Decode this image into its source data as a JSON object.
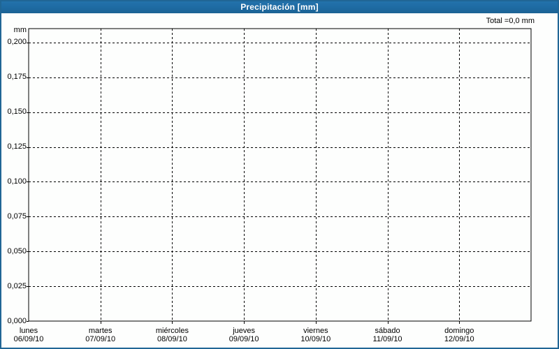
{
  "window": {
    "title": "Precipitación [mm]"
  },
  "chart_data": {
    "type": "bar",
    "title": "Precipitación [mm]",
    "total_annotation": "Total =0,0 mm",
    "grid": true,
    "legend_position": "none",
    "y_axis": {
      "unit_label": "mm",
      "tick_values": [
        0,
        0.025,
        0.05,
        0.075,
        0.1,
        0.125,
        0.15,
        0.175,
        0.2
      ],
      "tick_labels": [
        "0,000",
        "0,025",
        "0,050",
        "0,075",
        "0,100",
        "0,125",
        "0,150",
        "0,175",
        "0,200"
      ],
      "lim": [
        0,
        0.21
      ]
    },
    "x_axis": {
      "categories": [
        {
          "day": "lunes",
          "date": "06/09/10"
        },
        {
          "day": "martes",
          "date": "07/09/10"
        },
        {
          "day": "miércoles",
          "date": "08/09/10"
        },
        {
          "day": "jueves",
          "date": "09/09/10"
        },
        {
          "day": "viernes",
          "date": "10/09/10"
        },
        {
          "day": "sábado",
          "date": "11/09/10"
        },
        {
          "day": "domingo",
          "date": "12/09/10"
        }
      ]
    },
    "series": [
      {
        "name": "Precipitación",
        "values": [
          0,
          0,
          0,
          0,
          0,
          0,
          0
        ]
      }
    ],
    "colors": {
      "titlebar_blue": "#1e6ba3",
      "window_border_blue": "#206695",
      "grid_black": "#000000",
      "background_white": "#fdfefd",
      "title_text_white": "#ffffff"
    }
  }
}
